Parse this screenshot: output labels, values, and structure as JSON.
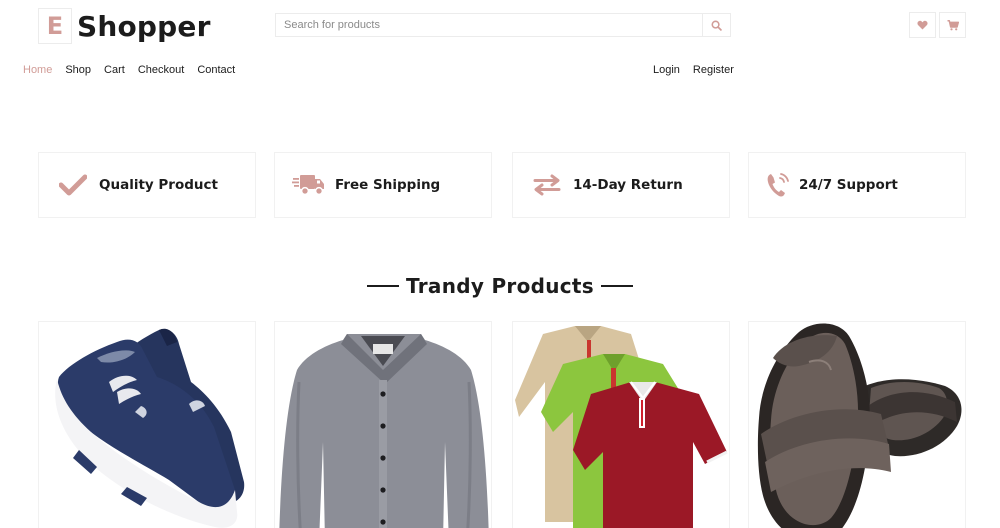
{
  "brand": {
    "logo_letter": "E",
    "name": "Shopper"
  },
  "search": {
    "placeholder": "Search for products"
  },
  "nav": {
    "items": [
      {
        "label": "Home",
        "active": true
      },
      {
        "label": "Shop"
      },
      {
        "label": "Cart"
      },
      {
        "label": "Checkout"
      },
      {
        "label": "Contact"
      }
    ],
    "login_label": "Login",
    "register_label": "Register"
  },
  "header_icons": [
    "heart-icon",
    "cart-icon"
  ],
  "features": [
    {
      "label": "Quality Product",
      "icon": "check-icon"
    },
    {
      "label": "Free Shipping",
      "icon": "shipping-truck-icon"
    },
    {
      "label": "14-Day Return",
      "icon": "exchange-arrows-icon"
    },
    {
      "label": "24/7 Support",
      "icon": "phone-icon"
    }
  ],
  "section": {
    "title": "Trandy Products"
  },
  "products": [
    {
      "image": "sneakers-image"
    },
    {
      "image": "grey-shirt-image"
    },
    {
      "image": "polo-tshirts-image"
    },
    {
      "image": "sandals-image"
    }
  ],
  "colors": {
    "accent": "#d19c97",
    "text": "#1c1c1c",
    "border": "#ececec"
  }
}
